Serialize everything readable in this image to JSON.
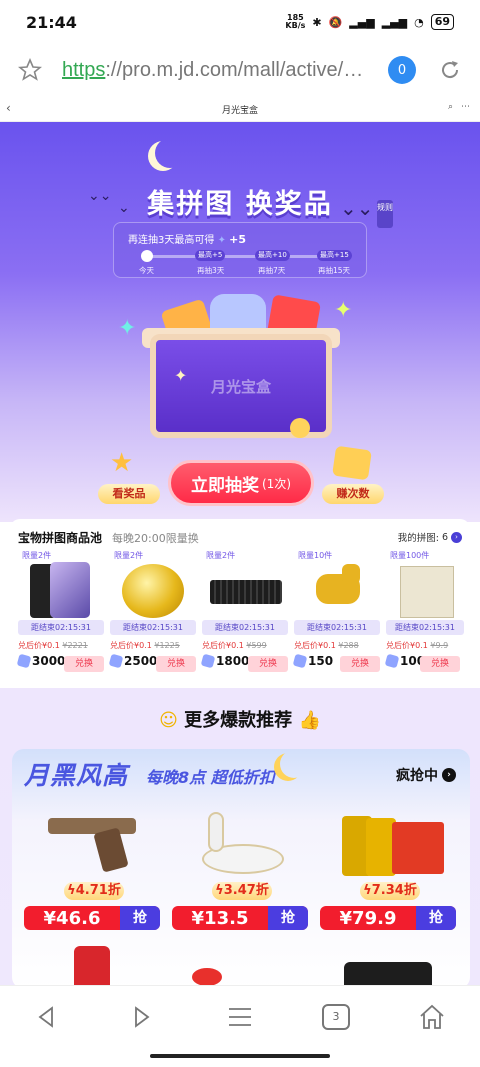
{
  "status_bar": {
    "time": "21:44",
    "net_speed_value": "185",
    "net_speed_unit": "KB/s",
    "battery": "69"
  },
  "browser": {
    "url_scheme": "https",
    "url_rest": "://pro.m.jd.com/mall/active/…",
    "tab_count": "0",
    "page_title": "月光宝盒",
    "bottom_tab_count": "3"
  },
  "hero": {
    "title": "集拼图 换奖品",
    "rules": "规则",
    "streak_text": "再连抽3天最高可得",
    "streak_bonus": "+5",
    "milestones": [
      {
        "badge": "",
        "label": "今天"
      },
      {
        "badge": "最高+5",
        "label": "再抽3天"
      },
      {
        "badge": "最高+10",
        "label": "再抽7天"
      },
      {
        "badge": "最高+15",
        "label": "再抽15天"
      }
    ],
    "chest_label": "月光宝盒",
    "left_button": "看奖品",
    "draw_button": "立即抽奖",
    "draw_count": "(1次)",
    "right_button": "赚次数"
  },
  "pool": {
    "title": "宝物拼图商品池",
    "subtitle": "每晚20:00限量换",
    "my_puzzle_label": "我的拼图:",
    "my_puzzle_count": "6",
    "items": [
      {
        "limit": "限量2件",
        "timer": "距结束02:15:31",
        "price_prefix": "兑后价¥0.1",
        "orig_price": "¥2221",
        "pieces": "3000",
        "redeem": "兑换"
      },
      {
        "limit": "限量2件",
        "timer": "距结束02:15:31",
        "price_prefix": "兑后价¥0.1",
        "orig_price": "¥1225",
        "pieces": "2500",
        "redeem": "兑换"
      },
      {
        "limit": "限量2件",
        "timer": "距结束02:15:31",
        "price_prefix": "兑后价¥0.1",
        "orig_price": "¥599",
        "pieces": "1800",
        "redeem": "兑换"
      },
      {
        "limit": "限量10件",
        "timer": "距结束02:15:31",
        "price_prefix": "兑后价¥0.1",
        "orig_price": "¥288",
        "pieces": "150",
        "redeem": "兑换"
      },
      {
        "limit": "限量100件",
        "timer": "距结束02:15:31",
        "price_prefix": "兑后价¥0.1",
        "orig_price": "¥9.9",
        "pieces": "100",
        "redeem": "兑换"
      }
    ]
  },
  "recommend": {
    "title": "更多爆款推荐",
    "banner_title": "月黑风高",
    "banner_subtitle": "每晚8点 超低折扣",
    "snap_label": "疯抢中",
    "deals": [
      {
        "discount": "4.71折",
        "price": "¥46.6",
        "grab": "抢"
      },
      {
        "discount": "3.47折",
        "price": "¥13.5",
        "grab": "抢"
      },
      {
        "discount": "7.34折",
        "price": "¥79.9",
        "grab": "抢"
      }
    ]
  },
  "colors": {
    "accent_purple": "#6a53ee",
    "price_red": "#f21d2d",
    "url_green": "#33a853",
    "tab_blue": "#2f8cf2"
  }
}
